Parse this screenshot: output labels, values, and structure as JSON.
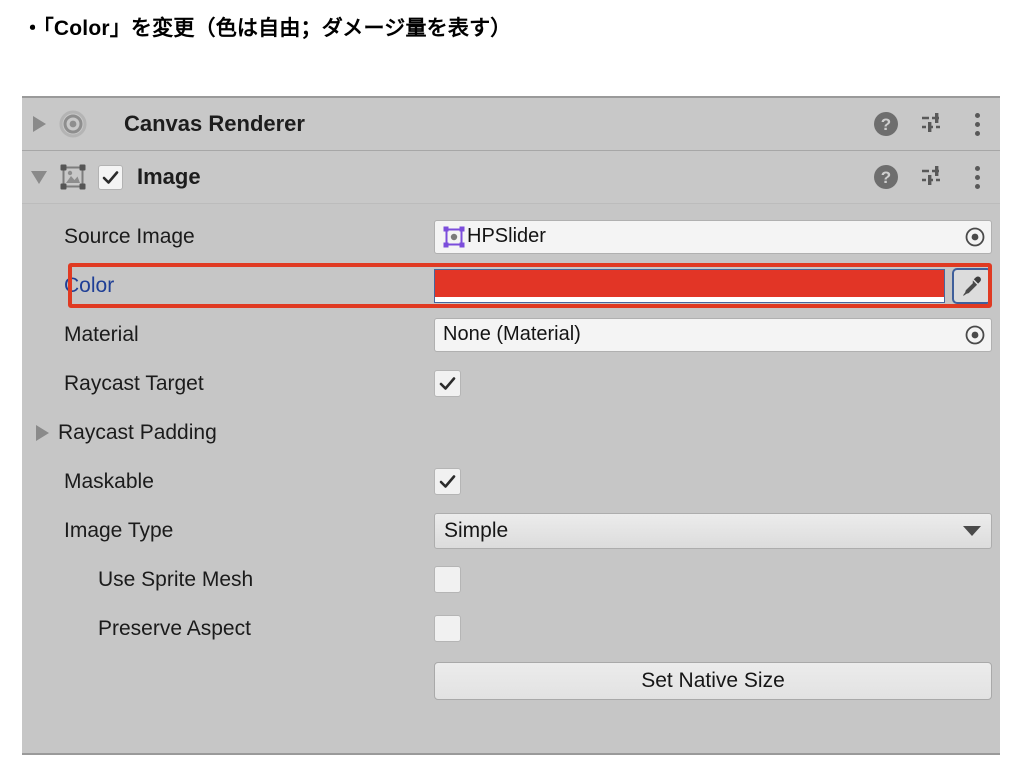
{
  "slide": {
    "heading": "・「Color」を変更（色は自由；ダメージ量を表す）"
  },
  "inspector": {
    "components": [
      {
        "name": "Canvas Renderer",
        "icon": "canvas-renderer-icon",
        "expanded": false,
        "has_enable_checkbox": false,
        "tools": {
          "help": "?",
          "settings": "preset-icon",
          "menu": "kebab-icon"
        }
      },
      {
        "name": "Image",
        "icon": "image-component-icon",
        "expanded": true,
        "has_enable_checkbox": true,
        "enabled": true,
        "tools": {
          "help": "?",
          "settings": "preset-icon",
          "menu": "kebab-icon"
        }
      }
    ],
    "properties": {
      "source_image": {
        "label": "Source Image",
        "value": "HPSlider"
      },
      "color": {
        "label": "Color",
        "value_hex": "#e23526",
        "alpha_bar": "#ffffff",
        "modified": true
      },
      "material": {
        "label": "Material",
        "value": "None (Material)"
      },
      "raycast_target": {
        "label": "Raycast Target",
        "checked": true
      },
      "raycast_padding": {
        "label": "Raycast Padding",
        "expanded": false
      },
      "maskable": {
        "label": "Maskable",
        "checked": true
      },
      "image_type": {
        "label": "Image Type",
        "value": "Simple"
      },
      "use_sprite_mesh": {
        "label": "Use Sprite Mesh",
        "checked": false
      },
      "preserve_aspect": {
        "label": "Preserve Aspect",
        "checked": false
      },
      "set_native_size": {
        "label": "Set Native Size"
      }
    },
    "annotation": {
      "color_hex": "#e03a22",
      "target": "Color"
    }
  }
}
